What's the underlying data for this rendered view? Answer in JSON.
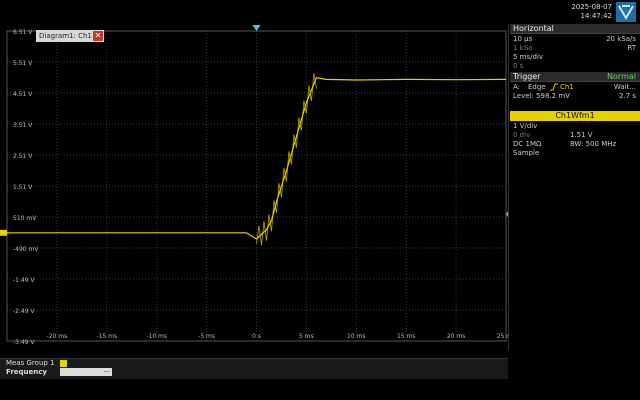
{
  "status": {
    "date": "2025-08-07",
    "time": "14:47:42"
  },
  "diagram": {
    "tab_label": "Diagram1: Ch1",
    "close_glyph": "✕"
  },
  "y_axis_labels": [
    "6.51 V",
    "5.51 V",
    "4.51 V",
    "3.51 V",
    "2.51 V",
    "1.51 V",
    "510 mV",
    "-490 mV",
    "-1.49 V",
    "-2.49 V",
    "-3.49 V"
  ],
  "x_axis_labels": [
    "-20 ms",
    "-15 ms",
    "-10 ms",
    "-5 ms",
    "0 s",
    "5 ms",
    "10 ms",
    "15 ms",
    "20 ms",
    "25 ms"
  ],
  "horizontal": {
    "title": "Horizontal",
    "rows": [
      {
        "left": "10 µs",
        "right": "20 kSa/s"
      },
      {
        "left": "1 kSa",
        "right": "RT"
      },
      {
        "left": "5 ms/div",
        "right": ""
      },
      {
        "left": "0 s",
        "right": ""
      }
    ]
  },
  "trigger": {
    "title": "Trigger",
    "mode": "Normal",
    "source_label": "A:",
    "type": "Edge",
    "channel": "Ch1",
    "state": "Wait...",
    "level": "Level: 598.2 mV",
    "time": "2.7 s"
  },
  "waveform": {
    "title": "Ch1Wfm1",
    "rows": [
      {
        "left": "1 V/div",
        "right": ""
      },
      {
        "left": "0 div",
        "right": "1.51 V"
      },
      {
        "left": "DC 1MΩ",
        "right": "BW: 500 MHz"
      },
      {
        "left": "Sample",
        "right": ""
      }
    ]
  },
  "measurements": {
    "group": "Meas Group 1",
    "label": "Frequency",
    "value": "---"
  },
  "markers": {
    "ch1_marker": "1",
    "trigger_marker": "T"
  },
  "colors": {
    "trace": "#e6d200",
    "grid": "#3a3a3a",
    "accent": "#e6d200"
  },
  "chart_data": {
    "type": "line",
    "xlabel": "",
    "ylabel": "",
    "xlim": [
      -25,
      25
    ],
    "ylim": [
      -3.49,
      6.51
    ],
    "series": [
      {
        "x": [
          -25,
          -1,
          0,
          1,
          1.5,
          2,
          3,
          4,
          5,
          6,
          7,
          10,
          15,
          20,
          25
        ],
        "values": [
          0.0,
          0.0,
          -0.2,
          0.1,
          0.4,
          1.0,
          2.0,
          3.1,
          4.2,
          5.0,
          4.95,
          4.93,
          4.95,
          4.94,
          4.95
        ]
      }
    ]
  }
}
